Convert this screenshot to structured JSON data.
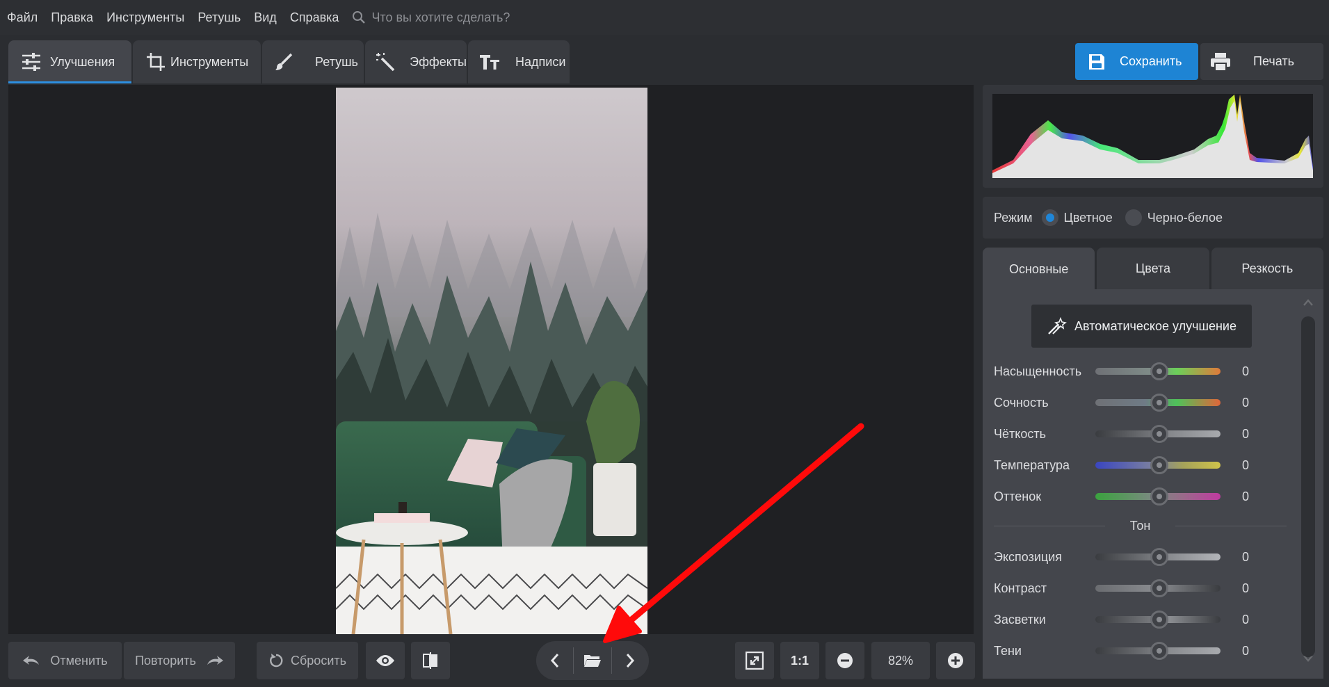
{
  "menu": {
    "items": [
      "Файл",
      "Правка",
      "Инструменты",
      "Ретушь",
      "Вид",
      "Справка"
    ],
    "search_placeholder": "Что вы хотите сделать?"
  },
  "tabs": [
    {
      "label": "Улучшения",
      "icon": "sliders-icon",
      "active": true
    },
    {
      "label": "Инструменты",
      "icon": "crop-icon",
      "active": false
    },
    {
      "label": "Ретушь",
      "icon": "brush-icon",
      "active": false
    },
    {
      "label": "Эффекты",
      "icon": "magic-wand-icon",
      "active": false
    },
    {
      "label": "Надписи",
      "icon": "text-icon",
      "active": false
    }
  ],
  "actions": {
    "save": "Сохранить",
    "print": "Печать"
  },
  "mode": {
    "label": "Режим",
    "options": [
      "Цветное",
      "Черно-белое"
    ],
    "selected": "Цветное"
  },
  "subtabs": [
    {
      "label": "Основные",
      "active": true
    },
    {
      "label": "Цвета",
      "active": false
    },
    {
      "label": "Резкость",
      "active": false
    }
  ],
  "auto_enhance": "Автоматическое улучшение",
  "sliders_main": [
    {
      "label": "Насыщенность",
      "value": "0",
      "gradient": "sat"
    },
    {
      "label": "Сочность",
      "value": "0",
      "gradient": "vib"
    },
    {
      "label": "Чёткость",
      "value": "0",
      "gradient": "gray"
    },
    {
      "label": "Температура",
      "value": "0",
      "gradient": "temp"
    },
    {
      "label": "Оттенок",
      "value": "0",
      "gradient": "tint"
    }
  ],
  "section_tone": "Тон",
  "sliders_tone": [
    {
      "label": "Экспозиция",
      "value": "0"
    },
    {
      "label": "Контраст",
      "value": "0"
    },
    {
      "label": "Засветки",
      "value": "0"
    },
    {
      "label": "Тени",
      "value": "0"
    }
  ],
  "bottom": {
    "undo": "Отменить",
    "redo": "Повторить",
    "reset": "Сбросить",
    "one_to_one": "1:1",
    "zoom": "82%"
  },
  "colors": {
    "accent": "#1e84d4",
    "arrow": "#ff0a0a",
    "canvas": "#1f2023"
  }
}
